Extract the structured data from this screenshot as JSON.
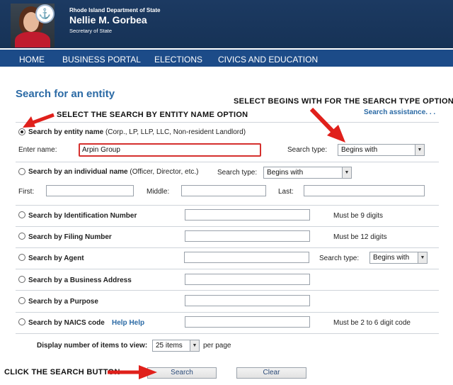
{
  "header": {
    "department": "Rhode Island Department of State",
    "officer_name": "Nellie M. Gorbea",
    "officer_role": "Secretary of State"
  },
  "nav": {
    "items": [
      "HOME",
      "BUSINESS PORTAL",
      "ELECTIONS",
      "CIVICS AND EDUCATION"
    ]
  },
  "page": {
    "title": "Search for an entity",
    "assistance_link": "Search assistance. . ."
  },
  "annotations": {
    "entity_name": "SELECT THE SEARCH BY ENTITY NAME OPTION",
    "begins_with": "SELECT BEGINS WITH FOR THE SEARCH TYPE OPTION",
    "search_button": "CLICK THE SEARCH BUTTON"
  },
  "form": {
    "entity_name": {
      "bold": "Search by entity name",
      "note": "(Corp., LP, LLP, LLC, Non-resident Landlord)",
      "enter_label": "Enter name:",
      "value": "Arpin Group",
      "search_type_label": "Search type:",
      "search_type_value": "Begins with"
    },
    "individual": {
      "bold": "Search by an individual name",
      "note": "(Officer, Director, etc.)",
      "search_type_label": "Search type:",
      "search_type_value": "Begins with",
      "first_label": "First:",
      "middle_label": "Middle:",
      "last_label": "Last:"
    },
    "id_number": {
      "label": "Search by Identification Number",
      "help": "Must be 9 digits"
    },
    "filing_number": {
      "label": "Search by Filing Number",
      "help": "Must be 12 digits"
    },
    "agent": {
      "label": "Search by Agent",
      "search_type_label": "Search type:",
      "search_type_value": "Begins with"
    },
    "business_address": {
      "label": "Search by a Business Address"
    },
    "purpose": {
      "label": "Search by a Purpose"
    },
    "naics": {
      "label": "Search by NAICS code",
      "help_link": "Help Help",
      "help": "Must be 2 to 6 digit code"
    },
    "display": {
      "label": "Display number of items to view:",
      "value": "25 items",
      "suffix": "per page"
    },
    "buttons": {
      "search": "Search",
      "clear": "Clear"
    }
  },
  "colors": {
    "header_bg": "#1c3a62",
    "nav_bg": "#1c4b88",
    "link_blue": "#2b6aa5",
    "annotation_red": "#e0201b"
  }
}
